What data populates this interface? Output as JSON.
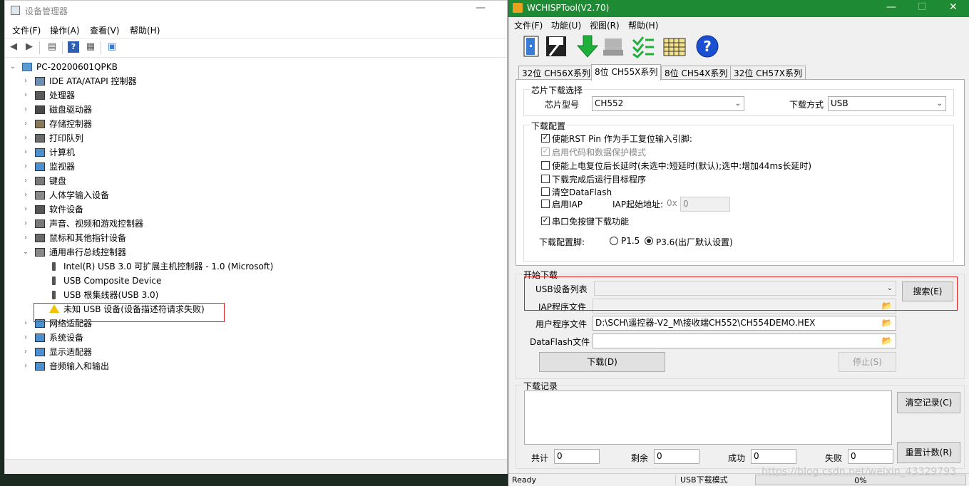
{
  "device_manager": {
    "title": "设备管理器",
    "menu": [
      "文件(F)",
      "操作(A)",
      "查看(V)",
      "帮助(H)"
    ],
    "root": "PC-20200601QPKB",
    "categories": [
      {
        "label": "IDE ATA/ATAPI 控制器",
        "icon": "ide-controller-icon"
      },
      {
        "label": "处理器",
        "icon": "processor-icon"
      },
      {
        "label": "磁盘驱动器",
        "icon": "disk-drive-icon"
      },
      {
        "label": "存储控制器",
        "icon": "storage-controller-icon"
      },
      {
        "label": "打印队列",
        "icon": "printer-icon"
      },
      {
        "label": "计算机",
        "icon": "computer-icon"
      },
      {
        "label": "监视器",
        "icon": "monitor-icon"
      },
      {
        "label": "键盘",
        "icon": "keyboard-icon"
      },
      {
        "label": "人体学输入设备",
        "icon": "hid-icon"
      },
      {
        "label": "软件设备",
        "icon": "software-device-icon"
      },
      {
        "label": "声音、视频和游戏控制器",
        "icon": "sound-icon"
      },
      {
        "label": "鼠标和其他指针设备",
        "icon": "mouse-icon"
      },
      {
        "label": "通用串行总线控制器",
        "icon": "usb-controller-icon"
      }
    ],
    "usb_children": [
      {
        "label": "Intel(R) USB 3.0 可扩展主机控制器 - 1.0 (Microsoft)",
        "icon": "usb-plug-icon"
      },
      {
        "label": "USB Composite Device",
        "icon": "usb-plug-icon"
      },
      {
        "label": "USB 根集线器(USB 3.0)",
        "icon": "usb-plug-icon"
      },
      {
        "label": "未知 USB 设备(设备描述符请求失败)",
        "icon": "warning-usb-icon"
      }
    ],
    "categories_after": [
      {
        "label": "网络适配器",
        "icon": "network-adapter-icon"
      },
      {
        "label": "系统设备",
        "icon": "system-device-icon"
      },
      {
        "label": "显示适配器",
        "icon": "display-adapter-icon"
      },
      {
        "label": "音频输入和输出",
        "icon": "audio-io-icon"
      }
    ]
  },
  "wch": {
    "title": "WCHISPTool(V2.70)",
    "menu": [
      "文件(F)",
      "功能(U)",
      "视图(R)",
      "帮助(H)"
    ],
    "tabs": [
      "32位 CH56X系列",
      "8位 CH55X系列",
      "8位 CH54X系列",
      "32位 CH57X系列"
    ],
    "chip_group": "芯片下载选择",
    "chip_label": "芯片型号",
    "chip_value": "CH552",
    "mode_label": "下载方式",
    "mode_value": "USB",
    "config_group": "下载配置",
    "options": [
      {
        "label": "使能RST Pin 作为手工复位输入引脚:",
        "checked": true,
        "disabled": false
      },
      {
        "label": "启用代码和数据保护模式",
        "checked": true,
        "disabled": true
      },
      {
        "label": "使能上电复位后长延时(未选中:短延时(默认);选中:增加44ms长延时)",
        "checked": false,
        "disabled": false
      },
      {
        "label": "下载完成后运行目标程序",
        "checked": false,
        "disabled": false
      },
      {
        "label": "清空DataFlash",
        "checked": false,
        "disabled": false
      },
      {
        "label": "启用IAP",
        "checked": false,
        "disabled": false
      },
      {
        "label": "串口免按键下载功能",
        "checked": true,
        "disabled": false
      }
    ],
    "iap_addr_label": "IAP起始地址:",
    "iap_prefix": "0x",
    "iap_value": "0",
    "pin_label": "下载配置脚:",
    "pin_options": [
      "P1.5",
      "P3.6(出厂默认设置)"
    ],
    "start_group": "开始下载",
    "usb_list_label": "USB设备列表",
    "usb_list_value": "",
    "search_button": "搜索(E)",
    "iap_file_label": "IAP程序文件",
    "iap_file_value": "",
    "user_file_label": "用户程序文件",
    "user_file_value": "D:\\SCH\\遥控器-V2_M\\接收端CH552\\CH554DEMO.HEX",
    "dataflash_label": "DataFlash文件",
    "dataflash_value": "",
    "download_button": "下载(D)",
    "stop_button": "停止(S)",
    "log_group": "下载记录",
    "clear_log_button": "清空记录(C)",
    "reset_count_button": "重置计数(R)",
    "counters": [
      {
        "label": "共计",
        "value": "0"
      },
      {
        "label": "剩余",
        "value": "0"
      },
      {
        "label": "成功",
        "value": "0"
      },
      {
        "label": "失败",
        "value": "0"
      }
    ],
    "status": {
      "ready": "Ready",
      "mode": "USB下载模式",
      "progress": "0%"
    }
  },
  "watermark": "https://blog.csdn.net/weixin_43329793"
}
